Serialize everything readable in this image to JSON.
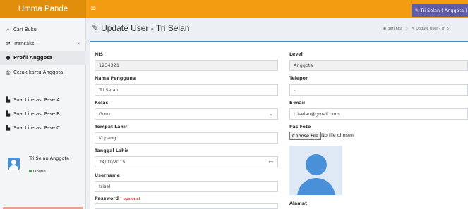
{
  "app": {
    "brand": "Umma Pande",
    "menu_icon": "≡",
    "user_chip": "Tri Selan ( Anggota )",
    "accent_color": "#f39c12",
    "brand_color": "#e08e0b",
    "chip_color": "#605ca8"
  },
  "sidebar": {
    "items": [
      {
        "icon": "search-icon",
        "label": "Cari Buku"
      },
      {
        "icon": "exchange-icon",
        "label": "Transaksi",
        "chevron": "‹"
      },
      {
        "icon": "user-icon",
        "label": "Profil Anggota",
        "active": true
      },
      {
        "icon": "print-icon",
        "label": "Cetak kartu Anggota"
      },
      {
        "icon": "file-icon",
        "label": "Soal Literasi Fase A"
      },
      {
        "icon": "file-icon",
        "label": "Soal Literasi Fase B"
      },
      {
        "icon": "file-icon",
        "label": "Soal Literasi Fase C"
      }
    ],
    "user": {
      "name": "Tri Selan Anggota",
      "status": "Online"
    }
  },
  "header": {
    "title": "Update User - Tri Selan",
    "breadcrumb": [
      "Beranda",
      "Update User - Tri S"
    ]
  },
  "form": {
    "nis": {
      "label": "NIS",
      "value": "1234321"
    },
    "nama": {
      "label": "Nama Pengguna",
      "value": "Tri Selan"
    },
    "kelas": {
      "label": "Kelas",
      "value": "Guru"
    },
    "tempat_lahir": {
      "label": "Tempat Lahir",
      "value": "Kupang"
    },
    "tanggal_lahir": {
      "label": "Tanggal Lahir",
      "value": "24/01/2015"
    },
    "username": {
      "label": "Username",
      "value": "trisel"
    },
    "password": {
      "label": "Password",
      "hint": "* opsional",
      "value": ""
    },
    "level": {
      "label": "Level",
      "value": "Anggota"
    },
    "telepon": {
      "label": "Telepon",
      "value": "-"
    },
    "email": {
      "label": "E-mail",
      "value": "triselan@gmail.com"
    },
    "pas_foto": {
      "label": "Pas Foto",
      "button": "Choose File",
      "status": "No file chosen"
    },
    "alamat": {
      "label": "Alamat"
    }
  }
}
